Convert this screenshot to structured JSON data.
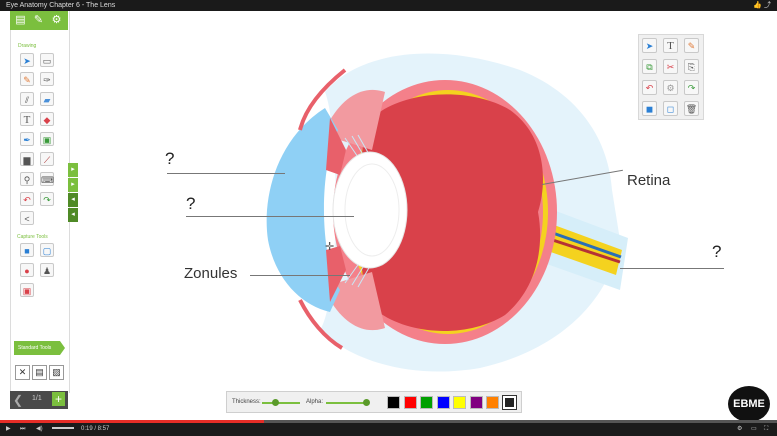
{
  "window": {
    "title": "Eye Anatomy Chapter 6 - The Lens"
  },
  "sidebar": {
    "drawing_label": "Drawing",
    "capture_label": "Capture Tools",
    "standard_tools_label": "Standard Tools",
    "page_indicator": "1/1"
  },
  "diagram": {
    "labels": {
      "q1": "?",
      "q2": "?",
      "zonules": "Zonules",
      "retina": "Retina",
      "q3": "?"
    }
  },
  "linebar": {
    "thickness_label": "Thickness:",
    "alpha_label": "Alpha:",
    "thickness_value": 0.35,
    "alpha_value": 0.95,
    "colors": [
      "#000000",
      "#ff0000",
      "#00a000",
      "#0000ff",
      "#ffff00",
      "#800080",
      "#ff8000",
      "#222222"
    ]
  },
  "video": {
    "time": "0:19 / 8:57",
    "progress": 0.34
  },
  "logo": {
    "text": "EBME"
  },
  "colors": {
    "accent": "#7bbf3e",
    "cornea": "#8fd0f5",
    "sclera": "#f4808a",
    "vitreous": "#d9414a",
    "retina": "#f4d21f"
  }
}
